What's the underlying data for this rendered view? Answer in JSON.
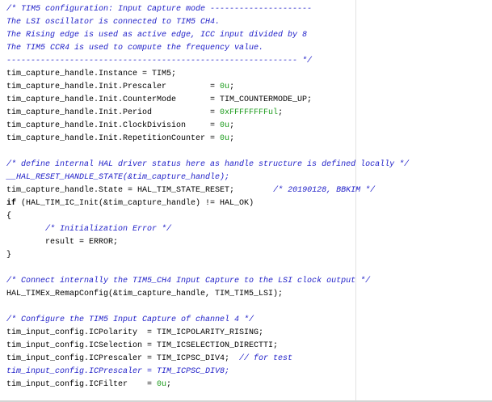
{
  "editor": {
    "lines": [
      [
        [
          "/* TIM5 configuration: Input Capture mode ---------------------",
          "comment"
        ]
      ],
      [
        [
          "The LSI oscillator is connected to TIM5 CH4.",
          "comment"
        ]
      ],
      [
        [
          "The Rising edge is used as active edge, ICC input divided by 8",
          "comment"
        ]
      ],
      [
        [
          "The TIM5 CCR4 is used to compute the frequency value.",
          "comment"
        ]
      ],
      [
        [
          "------------------------------------------------------------ */",
          "comment"
        ]
      ],
      [
        [
          "tim_capture_handle.Instance = TIM5;",
          "plain"
        ]
      ],
      [
        [
          "tim_capture_handle.Init.Prescaler         = ",
          "plain"
        ],
        [
          "0u",
          "number"
        ],
        [
          ";",
          "plain"
        ]
      ],
      [
        [
          "tim_capture_handle.Init.CounterMode       = TIM_COUNTERMODE_UP;",
          "plain"
        ]
      ],
      [
        [
          "tim_capture_handle.Init.Period            = ",
          "plain"
        ],
        [
          "0xFFFFFFFFul",
          "number"
        ],
        [
          ";",
          "plain"
        ]
      ],
      [
        [
          "tim_capture_handle.Init.ClockDivision     = ",
          "plain"
        ],
        [
          "0u",
          "number"
        ],
        [
          ";",
          "plain"
        ]
      ],
      [
        [
          "tim_capture_handle.Init.RepetitionCounter = ",
          "plain"
        ],
        [
          "0u",
          "number"
        ],
        [
          ";",
          "plain"
        ]
      ],
      [],
      [
        [
          "/* define internal HAL driver status here as handle structure is defined locally */",
          "comment"
        ]
      ],
      [
        [
          "__HAL_RESET_HANDLE_STATE(&tim_capture_handle);",
          "comment"
        ]
      ],
      [
        [
          "tim_capture_handle.State = HAL_TIM_STATE_RESET;        ",
          "plain"
        ],
        [
          "/* 20190128, BBKIM */",
          "comment"
        ]
      ],
      [
        [
          "if",
          "keyword"
        ],
        [
          " (HAL_TIM_IC_Init(&tim_capture_handle) != HAL_OK)",
          "plain"
        ]
      ],
      [
        [
          "{",
          "plain"
        ]
      ],
      [
        [
          "        ",
          "plain"
        ],
        [
          "/* Initialization Error */",
          "comment"
        ]
      ],
      [
        [
          "        result = ERROR;",
          "plain"
        ]
      ],
      [
        [
          "}",
          "plain"
        ]
      ],
      [],
      [
        [
          "/* Connect internally the TIM5_CH4 Input Capture to the LSI clock output */",
          "comment"
        ]
      ],
      [
        [
          "HAL_TIMEx_RemapConfig(&tim_capture_handle, TIM_TIM5_LSI);",
          "plain"
        ]
      ],
      [],
      [
        [
          "/* Configure the TIM5 Input Capture of channel 4 */",
          "comment"
        ]
      ],
      [
        [
          "tim_input_config.ICPolarity  = TIM_ICPOLARITY_RISING;",
          "plain"
        ]
      ],
      [
        [
          "tim_input_config.ICSelection = TIM_ICSELECTION_DIRECTTI;",
          "plain"
        ]
      ],
      [
        [
          "tim_input_config.ICPrescaler = TIM_ICPSC_DIV4;  ",
          "plain"
        ],
        [
          "// for test",
          "comment"
        ]
      ],
      [
        [
          "tim_input_config.ICPrescaler = TIM_ICPSC_DIV8;",
          "disabled"
        ]
      ],
      [
        [
          "tim_input_config.ICFilter    = ",
          "plain"
        ],
        [
          "0u",
          "number"
        ],
        [
          ";",
          "plain"
        ]
      ]
    ]
  }
}
